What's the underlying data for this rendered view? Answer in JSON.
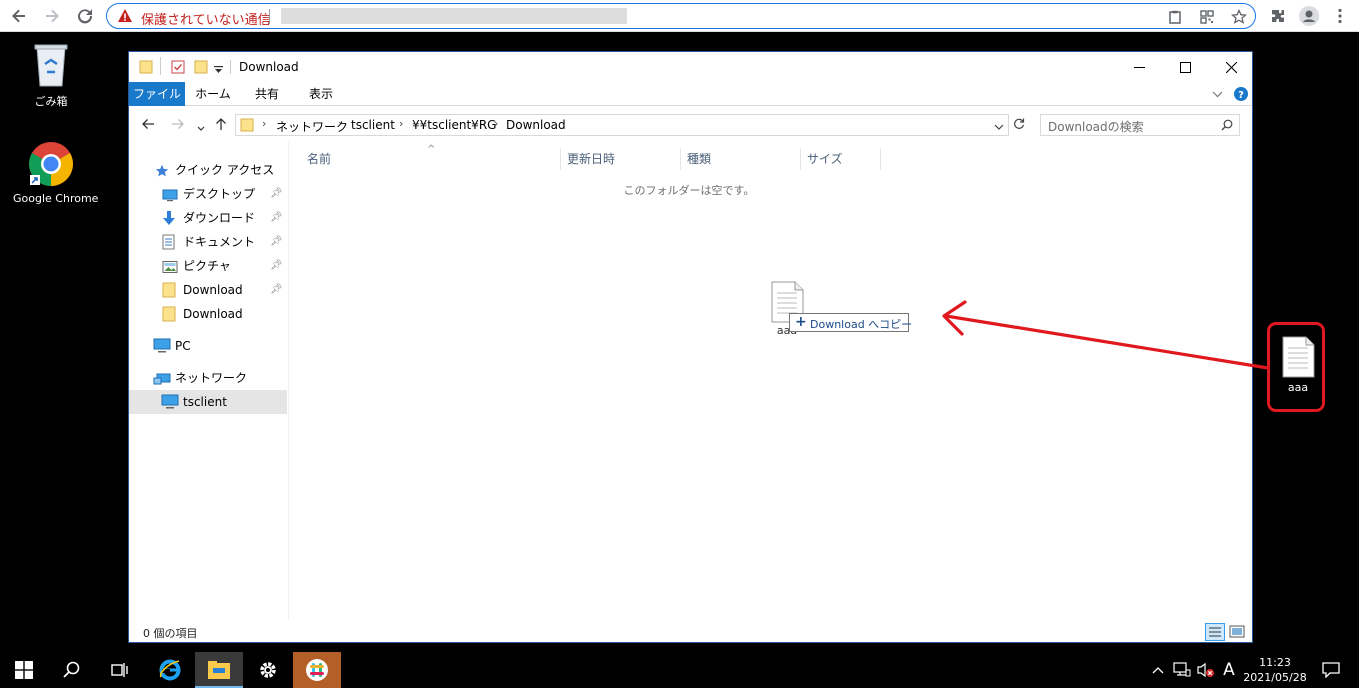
{
  "browser": {
    "security_text": "保護されていない通信"
  },
  "desktop": {
    "recycle_bin": "ごみ箱",
    "chrome": "Google Chrome",
    "dragged_file": "aaa"
  },
  "explorer": {
    "title": "Download",
    "ribbon_tabs": [
      "ファイル",
      "ホーム",
      "共有",
      "表示"
    ],
    "breadcrumb": [
      "ネットワーク",
      "tsclient",
      "¥¥tsclient¥RG",
      "Download"
    ],
    "search_placeholder": "Downloadの検索",
    "nav": {
      "quick_access": "クイック アクセス",
      "desktop": "デスクトップ",
      "downloads": "ダウンロード",
      "documents": "ドキュメント",
      "pictures": "ピクチャ",
      "download1": "Download",
      "download2": "Download",
      "pc": "PC",
      "network": "ネットワーク",
      "tsclient": "tsclient"
    },
    "columns": [
      "名前",
      "更新日時",
      "種類",
      "サイズ"
    ],
    "empty_message": "このフォルダーは空です。",
    "status": "0 個の項目",
    "drag_file_label": "aaa",
    "drag_tooltip": "Download へコピー"
  },
  "taskbar": {
    "time": "11:23",
    "date": "2021/05/28",
    "ime": "A"
  },
  "colors": {
    "file_tab": "#1979ca",
    "annotation_red": "#e0191f",
    "window_border": "#2b5797"
  }
}
